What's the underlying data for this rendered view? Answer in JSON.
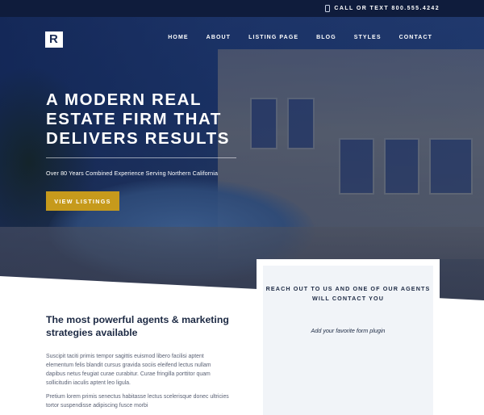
{
  "topbar": {
    "phone_text": "CALL OR TEXT 800.555.4242",
    "phone_icon": "phone-icon"
  },
  "logo": {
    "letter": "R"
  },
  "nav": {
    "items": [
      {
        "label": "HOME"
      },
      {
        "label": "ABOUT"
      },
      {
        "label": "LISTING PAGE"
      },
      {
        "label": "BLOG"
      },
      {
        "label": "STYLES"
      },
      {
        "label": "CONTACT"
      }
    ]
  },
  "hero": {
    "headline": "A MODERN REAL ESTATE FIRM THAT DELIVERS RESULTS",
    "subtitle": "Over 80 Years Combined Experience Serving Northern California",
    "cta_label": "VIEW LISTINGS"
  },
  "contact_box": {
    "title": "REACH OUT TO US AND ONE OF OUR AGENTS WILL CONTACT YOU",
    "placeholder": "Add your favorite form plugin"
  },
  "content": {
    "heading": "The most powerful agents & marketing strategies available",
    "paragraph1": "Suscipit taciti primis tempor sagittis euismod libero facilisi aptent elementum felis blandit cursus gravida sociis eleifend lectus nullam dapibus netus feugiat curae curabitur. Curae fringilla porttitor quam sollicitudin iaculis aptent leo ligula.",
    "paragraph2": "Pretium lorem primis senectus habitasse lectus scelerisque donec ultricies tortor suspendisse adipiscing fusce morbi"
  },
  "colors": {
    "navy": "#0f1c3c",
    "gold": "#c69a1c",
    "form_bg": "#f1f4f8",
    "text_dark": "#1d2a44"
  }
}
